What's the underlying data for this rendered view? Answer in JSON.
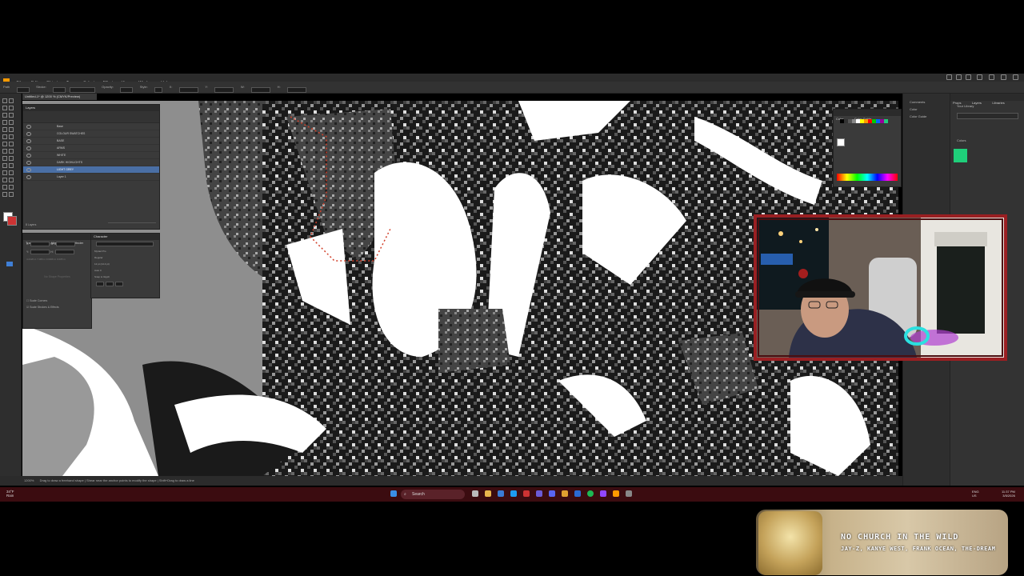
{
  "menus": [
    "File",
    "Edit",
    "Object",
    "Type",
    "Select",
    "Effect",
    "View",
    "Window",
    "Help"
  ],
  "control_bar": {
    "path_label": "Path",
    "stroke_label": "Stroke:",
    "opacity_label": "Opacity:",
    "opacity_value": "100%",
    "style_label": "Style:"
  },
  "document_tab": {
    "title": "Untitled-1* @ 1200 % (CMYK/Preview)"
  },
  "layers_panel": {
    "title": "Layers",
    "layers": [
      {
        "name": "Base"
      },
      {
        "name": "COLOUR SWATCHES"
      },
      {
        "name": "BASE"
      },
      {
        "name": "ARMS"
      },
      {
        "name": "WHITE"
      },
      {
        "name": "DARK HIGHLIGHTS"
      },
      {
        "name": "LIGHT GREY"
      },
      {
        "name": "Layer 1"
      }
    ],
    "footer": "8 Layers"
  },
  "transform_panel": {
    "tabs": [
      "Transform",
      "Align",
      "Pathfinder"
    ],
    "x_label": "X:",
    "x_value": "4.2426 in",
    "y_label": "Y:",
    "y_value": "7.006 in",
    "w_label": "W:",
    "w_value": "0.0006 in",
    "h_label": "H:",
    "h_value": "0.005 in",
    "empty_note": "No Shape Properties",
    "scale_corners": "Scale Corners",
    "scale_strokes": "Scale Strokes & Effects"
  },
  "character_panel": {
    "title": "Character",
    "font": "Myriad Pro",
    "style": "Regular",
    "size": "12 pt",
    "leading": "(14.4 pt)",
    "tracking": "Auto",
    "kerning": "0",
    "snap_label": "Snap to Glyph"
  },
  "color_panel": {
    "tabs": [
      "Color",
      "Color Guide"
    ],
    "swatch_colors": [
      "#000",
      "#333",
      "#555",
      "#888",
      "#fff",
      "#ff0",
      "#f90",
      "#f00",
      "#0c0",
      "#06f",
      "#909",
      "#1fcf7a"
    ]
  },
  "right_dock": {
    "items": [
      "Comments",
      "Color",
      "Color Guide"
    ]
  },
  "libraries_panel": {
    "tabs": [
      "Props",
      "Layers",
      "Libraries"
    ],
    "your_library": "Your Library",
    "colors_label": "Colors",
    "color": "#1fcf7a"
  },
  "status_bar": {
    "zoom": "1200%",
    "hint": "Drag to draw a freehand shape | Shear near the anchor points to modify the shape | Shift+Drag to draw a line"
  },
  "taskbar": {
    "weather_temp": "34°F",
    "weather_desc": "Rain",
    "search_placeholder": "Search",
    "language": "ENG",
    "region": "US",
    "time": "11:37 PM",
    "date": "3/5/2026"
  },
  "now_playing": {
    "title": "NO CHURCH IN THE WILD",
    "artists": "JAY-Z, KANYE WEST, FRANK OCEAN, THE-DREAM"
  }
}
